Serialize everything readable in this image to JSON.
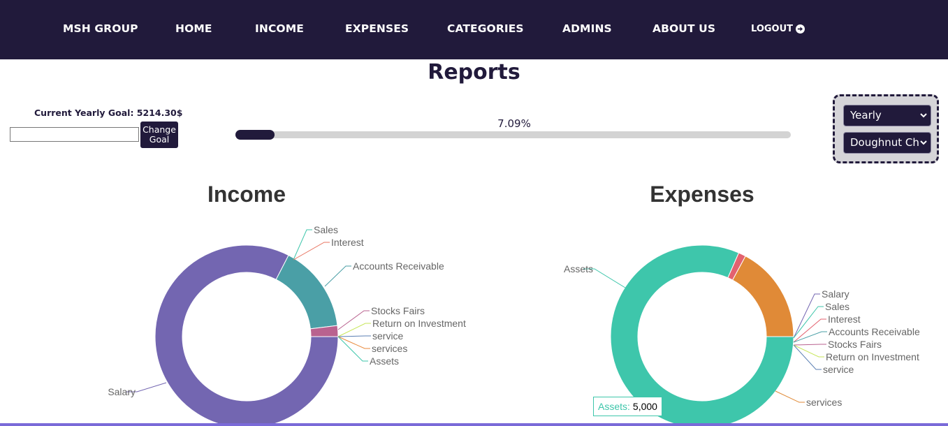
{
  "nav": {
    "brand": "MSH GROUP",
    "items": [
      "HOME",
      "INCOME",
      "EXPENSES",
      "CATEGORIES",
      "ADMINS",
      "ABOUT US"
    ],
    "logout": "LOGOUT"
  },
  "page": {
    "title": "Reports"
  },
  "goal": {
    "label": "Current Yearly Goal: 5214.30$",
    "input_value": "",
    "button_label": "Change\nGoal"
  },
  "progress": {
    "label": "7.09%",
    "value": 0.0709
  },
  "filters": {
    "period": "Yearly",
    "chart_type": "Doughnut Cha"
  },
  "colors": {
    "navbar": "#211a3b",
    "accent": "#211a3b",
    "progress_track": "#d3d3d3",
    "filter_box": "#d5d4d8"
  },
  "tooltip": {
    "name": "Assets:",
    "value": "5,000"
  },
  "chart_data": [
    {
      "type": "doughnut",
      "title": "Income",
      "labels": [
        "Salary",
        "Sales",
        "Interest",
        "Accounts Receivable",
        "Stocks Fairs",
        "Return on Investment",
        "service",
        "services",
        "Assets"
      ],
      "values": [
        3200,
        0,
        0,
        600,
        75,
        0,
        0,
        0,
        0
      ],
      "colors": [
        "#7366b1",
        "#3ec6ab",
        "#e8735f",
        "#4a9fa6",
        "#b9628f",
        "#c7e65a",
        "#5b7fb3",
        "#e88a3c",
        "#3ec6ab"
      ]
    },
    {
      "type": "doughnut",
      "title": "Expenses",
      "labels": [
        "Assets",
        "Salary",
        "Sales",
        "Interest",
        "Accounts Receivable",
        "Stocks Fairs",
        "Return on Investment",
        "service",
        "services"
      ],
      "values": [
        5000,
        0,
        0,
        80,
        0,
        0,
        0,
        0,
        1050
      ],
      "colors": [
        "#3ec6ab",
        "#7366b1",
        "#3ec6ab",
        "#e3626f",
        "#4a9fa6",
        "#b9628f",
        "#c7e65a",
        "#5b7fb3",
        "#e08a37"
      ]
    }
  ]
}
